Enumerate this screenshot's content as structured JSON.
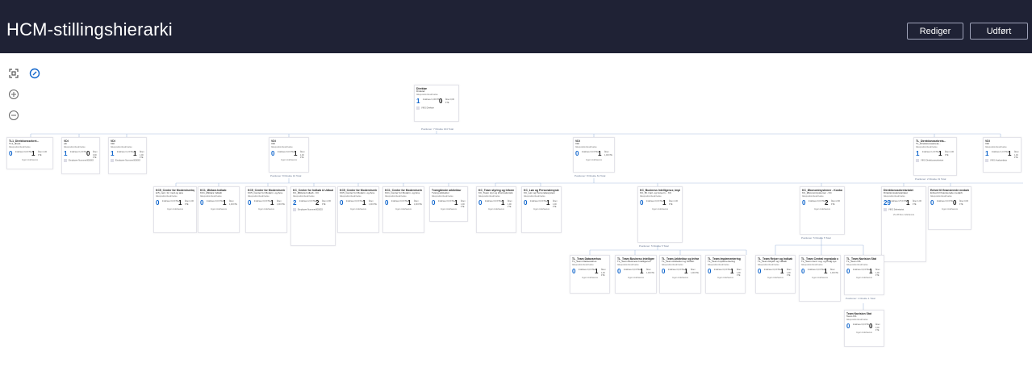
{
  "header": {
    "title": "HCM-stillingshierarki",
    "edit_label": "Rediger",
    "done_label": "Udført"
  },
  "toolbar": {
    "fit_icon": "fit-to-screen-icon",
    "center_icon": "center-target-icon",
    "zoom_in_icon": "zoom-in-icon",
    "zoom_out_icon": "zoom-out-icon"
  },
  "colors": {
    "header_bg": "#1f2235",
    "accent": "#1166cc",
    "connector": "#a9bfe0"
  },
  "labels": {
    "desc": "Ikkepositionbeskrivelse",
    "staff": "Indehavere",
    "fte": "Åben",
    "no_holder": "Ingen indehavere"
  },
  "root_positions_label": "Positioner: 7 Direkte 104 Total",
  "root": {
    "title": "Direktør",
    "sub": "Direktør",
    "n1": "1",
    "l1": "Indehaver 1,00 FTE",
    "n2": "0",
    "l2": "Åben 0,00 FTE",
    "emp": "VIKS Direktør"
  },
  "level1": [
    {
      "title": "TL1_Direktionssekret...",
      "sub": "TL1_direkt.",
      "n1": "0",
      "l1": "Indehaver 0,0 FTE",
      "n2": "1",
      "l2": "Åben 1,00 FTE",
      "foot": "Ingen indehavere"
    },
    {
      "title": "VDI",
      "sub": "vdi",
      "n1": "1",
      "l1": "Indehaver 1,0 FTE",
      "n2": "0",
      "l2": "Åben 0,00 FTE",
      "emp": "Employee Nummer000063"
    },
    {
      "title": "VDI",
      "sub": "VDI",
      "n1": "1",
      "l1": "Indehaver 1,0 FTE",
      "n2": "1",
      "l2": "Åben 1,00 FTE",
      "emp": "Employee Nummer000063"
    },
    {
      "title": "VDI",
      "sub": "VDI",
      "n1": "0",
      "l1": "Indehaver 0,0 FTE",
      "n2": "1",
      "l2": "Åben 1,00 FTE",
      "foot": "Ingen indehavere",
      "positions": "Positioner: 8 Direkte 10 Total"
    },
    {
      "title": "VDI",
      "sub": "VDI",
      "n1": "0",
      "l1": "Indehaver 0,0 FTE",
      "n2": "1",
      "l2": "Åben 1,00 FTE",
      "foot": "Ingen indehavere",
      "positions": "Positioner: 8 Direkte 61 Total"
    },
    {
      "title": "TL_Direktionssekreta...",
      "sub": "TL_Direktionssekreta...",
      "n1": "1",
      "l1": "Indehaver 1,0 FTE",
      "n2": "1",
      "l2": "Åben 1,00 FTE",
      "emp": "VIKS Direktionssekretær",
      "positions": "Positioner: 2 Direkte 31 Total"
    },
    {
      "title": "VDI",
      "sub": "VDI",
      "n1": "1",
      "l1": "Indehaver 1,0 FTE",
      "n2": "1",
      "l2": "Åben 1,00 FTE",
      "emp": "VIKS Analysedata"
    }
  ],
  "level2a": [
    {
      "title": "KC5_Center for Modernisering og Analyse",
      "sub": "kc5_cent. for mod og ana",
      "n1": "0",
      "l1": "Indehaver 0,0 FTE",
      "n2": "1",
      "l2": "Åben 1,00 FTE",
      "foot": "Ingen indehavere"
    },
    {
      "title": "KC1_Økitara Indkøb",
      "sub": "KC1_Økitara Indkøb",
      "n1": "0",
      "l1": "Indehaver 0,0 FTE",
      "n2": "1",
      "l2": "Åben 1,00 FTE",
      "foot": "Ingen indehavere"
    },
    {
      "title": "KC5_Center for Modernisering og Analyse",
      "sub": "KC5_Center for Modern. og Ana.",
      "n1": "0",
      "l1": "Indehaver 0,0 FTE",
      "n2": "1",
      "l2": "Åben 1,00 FTE",
      "foot": "Ingen indehavere"
    },
    {
      "title": "KC_Center for Indkøb & Udbud_Økitara Indkøb - Kontorchefen",
      "sub": "KC_Økitara Indkøb - KC",
      "n1": "2",
      "l1": "Indehaver 2,0 FTE",
      "n2": "2",
      "l2": "Åben 2,00 FTE",
      "emp": "Employee Nummer000053"
    },
    {
      "title": "KC5_Center for Modernisering og Analyse",
      "sub": "KC5_Center for Modern. og Ana.",
      "n1": "0",
      "l1": "Indehaver 0,0 FTE",
      "n2": "1",
      "l2": "Åben 1,00 FTE",
      "foot": "Ingen indehavere"
    },
    {
      "title": "KC1_Center for Modernisering og Analyse",
      "sub": "KC1_Center for Modern. og Ana.",
      "n1": "0",
      "l1": "Indehaver 0,0 FTE",
      "n2": "1",
      "l2": "Åben 1,00 FTE",
      "foot": "Ingen indehavere"
    },
    {
      "title": "Tværgående arkitektur",
      "sub": "Tværg arkitektur",
      "n1": "0",
      "l1": "Indehaver 0,0 FTE",
      "n2": "1",
      "l2": "Åben 1,00 FTE",
      "foot": "Ingen indehavere"
    }
  ],
  "level2b": [
    {
      "title": "KC_Team styring og Informationssikkerhed",
      "sub": "KC_Team styr og informationsik.",
      "n1": "0",
      "l1": "Indehaver 0,0 FTE",
      "n2": "1",
      "l2": "Åben 1,00 FTE",
      "foot": "Ingen indehavere"
    },
    {
      "title": "KC_Løn og Personalesystem",
      "sub": "KC_Løn og Personalesystem",
      "n1": "0",
      "l1": "Indehaver 0,0 FTE",
      "n2": "1",
      "l2": "Åben 1,00 FTE",
      "foot": "Ingen indehavere"
    },
    {
      "title": "KC_Business Intelligence, Implementering og Governance - Kontorchefen",
      "sub": "KC_BI, impl. og Govern. - KC",
      "n1": "0",
      "l1": "Indehaver 0,0 FTE",
      "n2": "1",
      "l2": "Åben 1,00 FTE",
      "foot": "Ingen indehavere",
      "positions": "Positioner: 5 Direkte 5 Total"
    },
    {
      "title": "KC_Økonomisystemer - Kontorchefen",
      "sub": "KC_Økonomisystemer - KC",
      "n1": "0",
      "l1": "Indehaver 0,0 FTE",
      "n2": "2",
      "l2": "Åben 2,00 FTE",
      "foot": "Ingen indehavere",
      "positions": "Positioner: 5 Direkte 5 Total"
    },
    {
      "title": "Direktionssekretariatet",
      "sub": "Direktionssekretariatet",
      "n1": "29",
      "l1": "Indehaver 27,0 FTE",
      "n2": "1",
      "l2": "Åben 1,00 FTE",
      "emp": "VIKS Sekretariat",
      "foot": "Vis 28 flere indehavere"
    },
    {
      "title": "Enhed til finansierede medarbejdere",
      "sub": "Enhed til finansierede medarb.",
      "n1": "0",
      "l1": "Indehaver 0,0 FTE",
      "n2": "0",
      "l2": "Åben 0,00 FTE",
      "foot": "Ingen indehavere"
    }
  ],
  "level3": [
    {
      "title": "TL_Team Datavarehus",
      "sub": "TL_Team Datavarehus",
      "n1": "0",
      "l1": "Indehaver 0,0 FTE",
      "n2": "1",
      "l2": "Åben 1,00 FTE",
      "foot": "Ingen indehavere"
    },
    {
      "title": "TL_Team Business Intelligence",
      "sub": "TL_Team Business Intelligence",
      "n1": "0",
      "l1": "Indehaver 0,0 FTE",
      "n2": "1",
      "l2": "Åben 1,00 FTE",
      "foot": "Ingen indehavere"
    },
    {
      "title": "TL_Team Arkitektur og Infrastruktur",
      "sub": "TL_Team Arkitektur og Infrastr.",
      "n1": "0",
      "l1": "Indehaver 0,0 FTE",
      "n2": "1",
      "l2": "Åben 1,00 FTE",
      "foot": "Ingen indehavere"
    },
    {
      "title": "TL_Team Implementering",
      "sub": "TL_Team Implementering",
      "n1": "0",
      "l1": "Indehaver 0,0 FTE",
      "n2": "1",
      "l2": "Åben 1,00 FTE",
      "foot": "Ingen indehavere"
    },
    {
      "title": "TL_Team Rejser og Indkøb",
      "sub": "TL_Team Rejser og Indkøb",
      "n1": "0",
      "l1": "Indehaver 0,0 FTE",
      "n2": "1",
      "l2": "Åben 1,00 FTE",
      "foot": "Ingen indehavere"
    },
    {
      "title": "TL_Team Central regnskab og budgetsystemer",
      "sub": "TL_Team Cent. reg. og budg.sys",
      "n1": "0",
      "l1": "Indehaver 0,0 FTE",
      "n2": "1",
      "l2": "Åben 1,00 FTE",
      "foot": "Ingen indehavere"
    },
    {
      "title": "TL_Team Navision Stat",
      "sub": "TL_Team NS",
      "n1": "0",
      "l1": "Indehaver 0,0 FTE",
      "n2": "1",
      "l2": "Åben 1,00 FTE",
      "foot": "Ingen indehavere",
      "positions": "Positioner: 1 Direkte 1 Total"
    }
  ],
  "level4": {
    "title": "Team Navision Stat",
    "sub": "Team NS",
    "n1": "0",
    "l1": "Indehaver 0,0 FTE",
    "n2": "0",
    "l2": "Åben 0,00 FTE",
    "foot": "Ingen indehavere"
  }
}
